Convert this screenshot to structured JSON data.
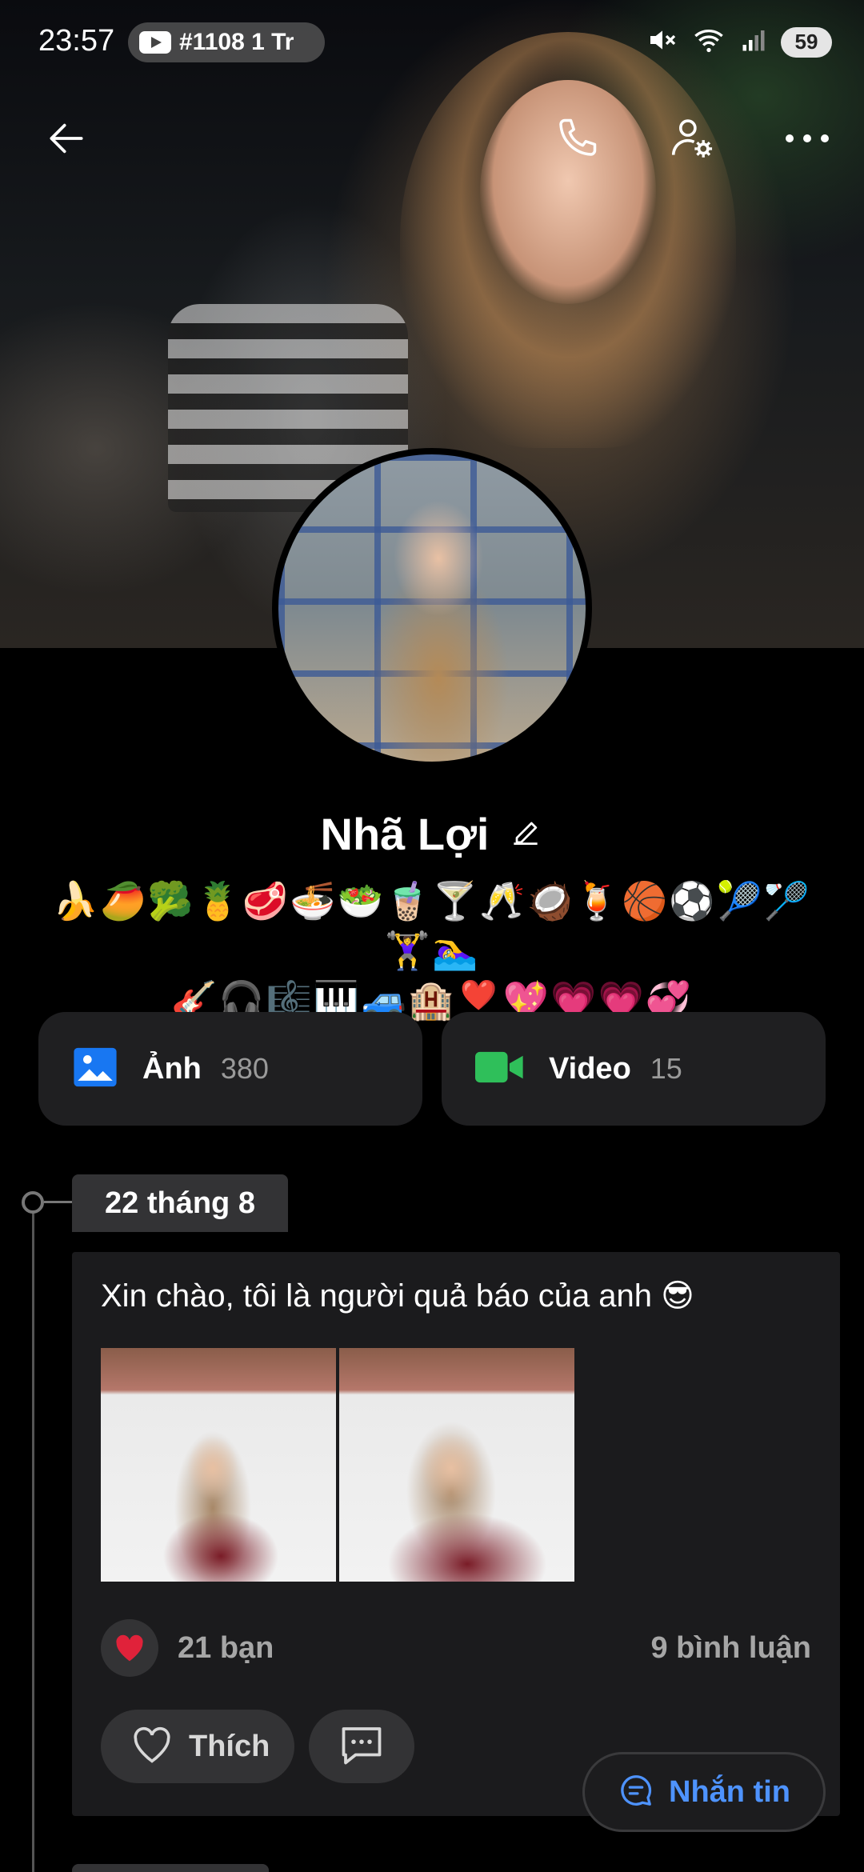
{
  "status_bar": {
    "time": "23:57",
    "media_text": "#1108 1 Tr",
    "battery": "59"
  },
  "profile": {
    "name": "Nhã Lợi",
    "bio_line1": "🍌🥭🥦🍍🥩🍜🥗🧋🍸🥂🥥🍹🏀⚽🎾🏸🏋‍♀️🏊‍♀️",
    "bio_line2": "🎸🎧🎼🎹🚙🏨❣️💖💗💗💞"
  },
  "media": {
    "photos_label": "Ảnh",
    "photos_count": "380",
    "videos_label": "Video",
    "videos_count": "15"
  },
  "timeline": {
    "date": "22 tháng 8"
  },
  "post": {
    "text": "Xin chào, tôi là người quả báo của anh 😎",
    "reactions": "21 bạn",
    "comments": "9 bình luận",
    "like_label": "Thích",
    "more": "•••"
  },
  "message_button": {
    "label": "Nhắn tin"
  },
  "colors": {
    "background": "#000000",
    "card": "#1f1f21",
    "accent_blue": "#4e93ff",
    "photo_icon": "#1877f2",
    "video_icon": "#2fbf5a",
    "heart": "#e0223a"
  }
}
